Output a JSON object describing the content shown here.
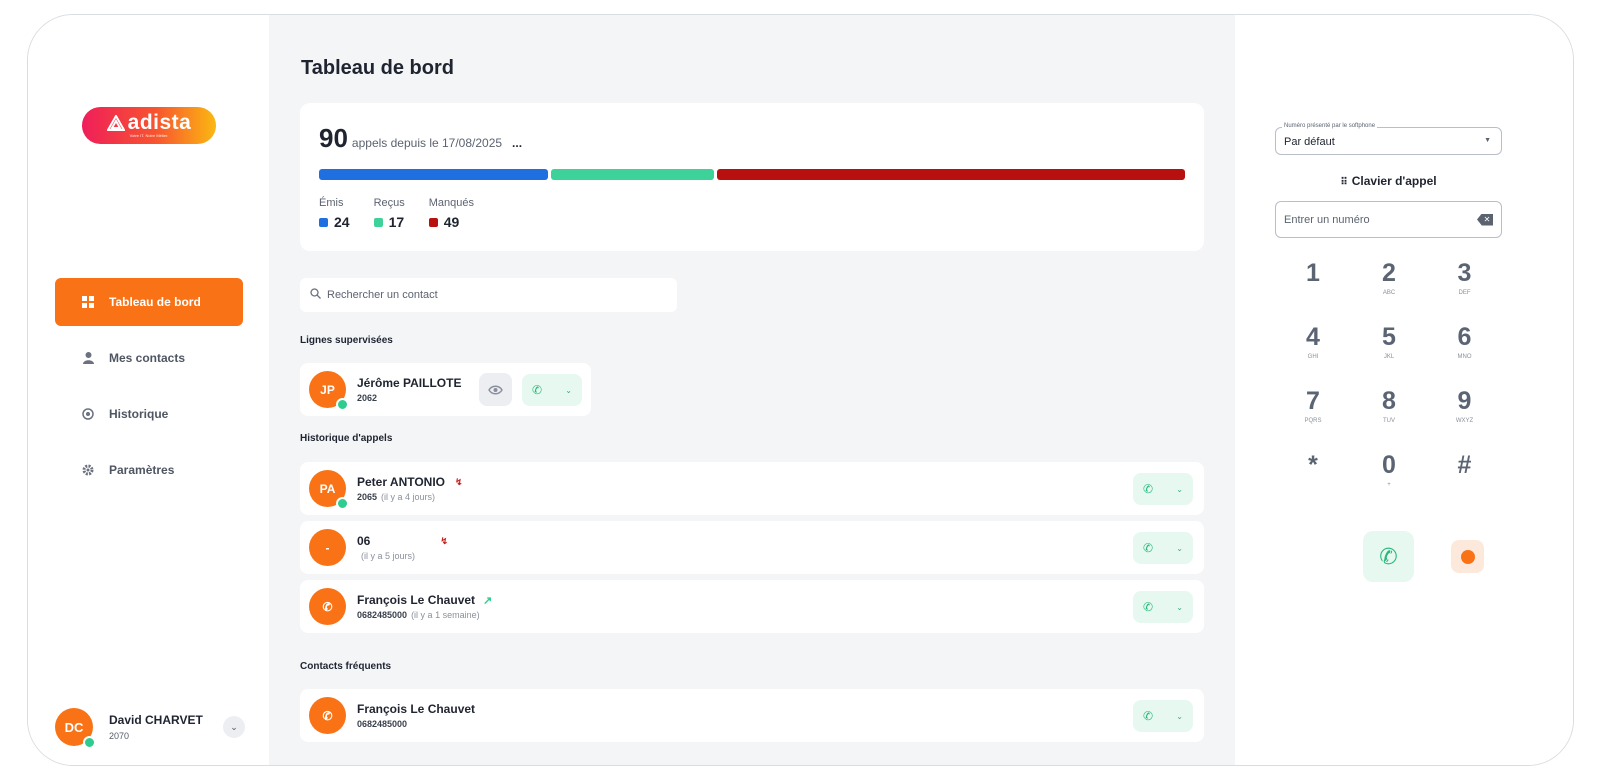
{
  "brand": {
    "name": "adista",
    "tagline": "Votre IT. Notre Métier."
  },
  "nav": [
    {
      "label": "Tableau de bord",
      "icon": "grid-icon",
      "active": true
    },
    {
      "label": "Mes contacts",
      "icon": "person-icon",
      "active": false
    },
    {
      "label": "Historique",
      "icon": "history-icon",
      "active": false
    },
    {
      "label": "Paramètres",
      "icon": "gear-icon",
      "active": false
    }
  ],
  "user": {
    "initials": "DC",
    "name": "David CHARVET",
    "ext": "2070"
  },
  "page_title": "Tableau de bord",
  "stats": {
    "total": "90",
    "since": "appels depuis le 17/08/2025",
    "more": "...",
    "legend": [
      {
        "label": "Émis",
        "value": "24",
        "color": "#1f6fe0"
      },
      {
        "label": "Reçus",
        "value": "17",
        "color": "#3dd29a"
      },
      {
        "label": "Manqués",
        "value": "49",
        "color": "#b80f0f"
      }
    ]
  },
  "search": {
    "placeholder": "Rechercher un contact"
  },
  "supervised": {
    "title": "Lignes supervisées",
    "items": [
      {
        "initials": "JP",
        "name": "Jérôme PAILLOTE",
        "ext": "2062"
      }
    ]
  },
  "history": {
    "title": "Historique d'appels",
    "items": [
      {
        "initials": "PA",
        "name": "Peter ANTONIO",
        "number": "2065",
        "ago": "(il y a 4 jours)",
        "type": "missed"
      },
      {
        "initials": "-",
        "name": "06",
        "number": "",
        "ago": "(il y a 5 jours)",
        "type": "missed"
      },
      {
        "initials": "",
        "name": "François Le Chauvet",
        "number": "0682485000",
        "ago": "(il y a 1 semaine)",
        "type": "outgoing"
      }
    ]
  },
  "frequent": {
    "title": "Contacts fréquents",
    "items": [
      {
        "name": "François Le Chauvet",
        "number": "0682485000"
      }
    ]
  },
  "dialer": {
    "select_label": "Numéro présenté par le softphone",
    "select_value": "Par défaut",
    "keypad_title": "Clavier d'appel",
    "input_placeholder": "Entrer un numéro",
    "keys": [
      {
        "d": "1",
        "l": ""
      },
      {
        "d": "2",
        "l": "ABC"
      },
      {
        "d": "3",
        "l": "DEF"
      },
      {
        "d": "4",
        "l": "GHI"
      },
      {
        "d": "5",
        "l": "JKL"
      },
      {
        "d": "6",
        "l": "MNO"
      },
      {
        "d": "7",
        "l": "PQRS"
      },
      {
        "d": "8",
        "l": "TUV"
      },
      {
        "d": "9",
        "l": "WXYZ"
      },
      {
        "d": "*",
        "l": ""
      },
      {
        "d": "0",
        "l": "+"
      },
      {
        "d": "#",
        "l": ""
      }
    ]
  },
  "colors": {
    "accent": "#f97316",
    "online": "#2ecc8f",
    "call_green": "#27b87a"
  }
}
